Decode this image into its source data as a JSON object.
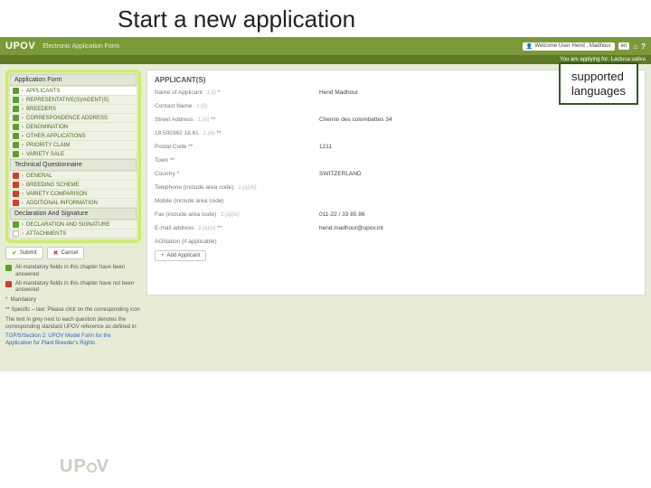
{
  "slide": {
    "title": "Start a new application"
  },
  "callout": {
    "line1": "supported",
    "line2": "languages"
  },
  "header": {
    "brand": "UPOV",
    "subtitle": "Electronic Application Form",
    "user_prefix": "Welcome User",
    "user_name": "Hend , Madhour",
    "lang": "en",
    "substrip": "You are applying for: Lactuca sativa"
  },
  "sidebar": {
    "section1": "Application Form",
    "section2": "Technical Questionnaire",
    "section3": "Declaration And Signature",
    "items1": [
      {
        "label": "APPLICANTS",
        "status": "green",
        "active": true
      },
      {
        "label": "REPRESENTATIVE(S)/AGENT(S)",
        "status": "green"
      },
      {
        "label": "BREEDERS",
        "status": "green"
      },
      {
        "label": "CORRESPONDENCE ADDRESS",
        "status": "green"
      },
      {
        "label": "DENOMINATION",
        "status": "green"
      },
      {
        "label": "OTHER APPLICATIONS",
        "status": "green"
      },
      {
        "label": "PRIORITY CLAIM",
        "status": "green"
      },
      {
        "label": "VARIETY SALE",
        "status": "green"
      }
    ],
    "items2": [
      {
        "label": "GENERAL",
        "status": "red"
      },
      {
        "label": "BREEDING SCHEME",
        "status": "red"
      },
      {
        "label": "VARIETY COMPARISON",
        "status": "red"
      },
      {
        "label": "ADDITIONAL INFORMATION",
        "status": "red"
      }
    ],
    "items3": [
      {
        "label": "DECLARATION AND SIGNATURE",
        "status": "green"
      },
      {
        "label": "ATTACHMENTS",
        "status": "white"
      }
    ],
    "submit_label": "Submit",
    "cancel_label": "Cancel",
    "legend_all_answered": "All mandatory fields in this chapter have been answered",
    "legend_not_answered": "All mandatory fields in this chapter have not been answered",
    "legend_mandatory": "Mandatory",
    "legend_specific": "Specific – law: Please click on the corresponding icon",
    "legend_greytext": "The text in grey next to each question denotes the corresponding standard UPOV reference as defined in:",
    "legend_link1": "TGP/5/Section 2: UPOV Model Form for the",
    "legend_link2": "Application for Plant Breeder's Rights"
  },
  "form": {
    "title": "APPLICANT(S)",
    "fields": [
      {
        "label": "Name of Applicant",
        "ref": "1.(i)",
        "req": "*",
        "value": "Hend Madhour"
      },
      {
        "label": "Contact Name",
        "ref": "1.(ii)",
        "value": ""
      },
      {
        "label": "Street Address",
        "ref": "1.(iii)",
        "req": "**",
        "value": "Chemin des colombettes 34"
      },
      {
        "label": "18.500362 18.61",
        "ref": "1.(iii)",
        "req": "**",
        "value": ""
      },
      {
        "label": "Postal Code",
        "req": "**",
        "value": "1211"
      },
      {
        "label": "Town",
        "req": "**",
        "value": ""
      },
      {
        "label": "Country",
        "req": "*",
        "value": "SWITZERLAND"
      },
      {
        "label": "Telephone (include area code)",
        "ref": "1.(a)(iii)",
        "value": ""
      },
      {
        "label": "Mobile (include area code)",
        "value": ""
      },
      {
        "label": "Fax (include area code)",
        "ref": "1.(a)(iv)",
        "value": "011-22 / 33 85 86"
      },
      {
        "label": "E-mail address",
        "ref": "1.(a)(v)",
        "req": "**",
        "value": "hend.madhour@upov.int"
      },
      {
        "label": "AGNation (if applicable)",
        "value": ""
      }
    ],
    "add_label": "Add Applicant"
  },
  "footer": {
    "brand": "UPOV"
  }
}
